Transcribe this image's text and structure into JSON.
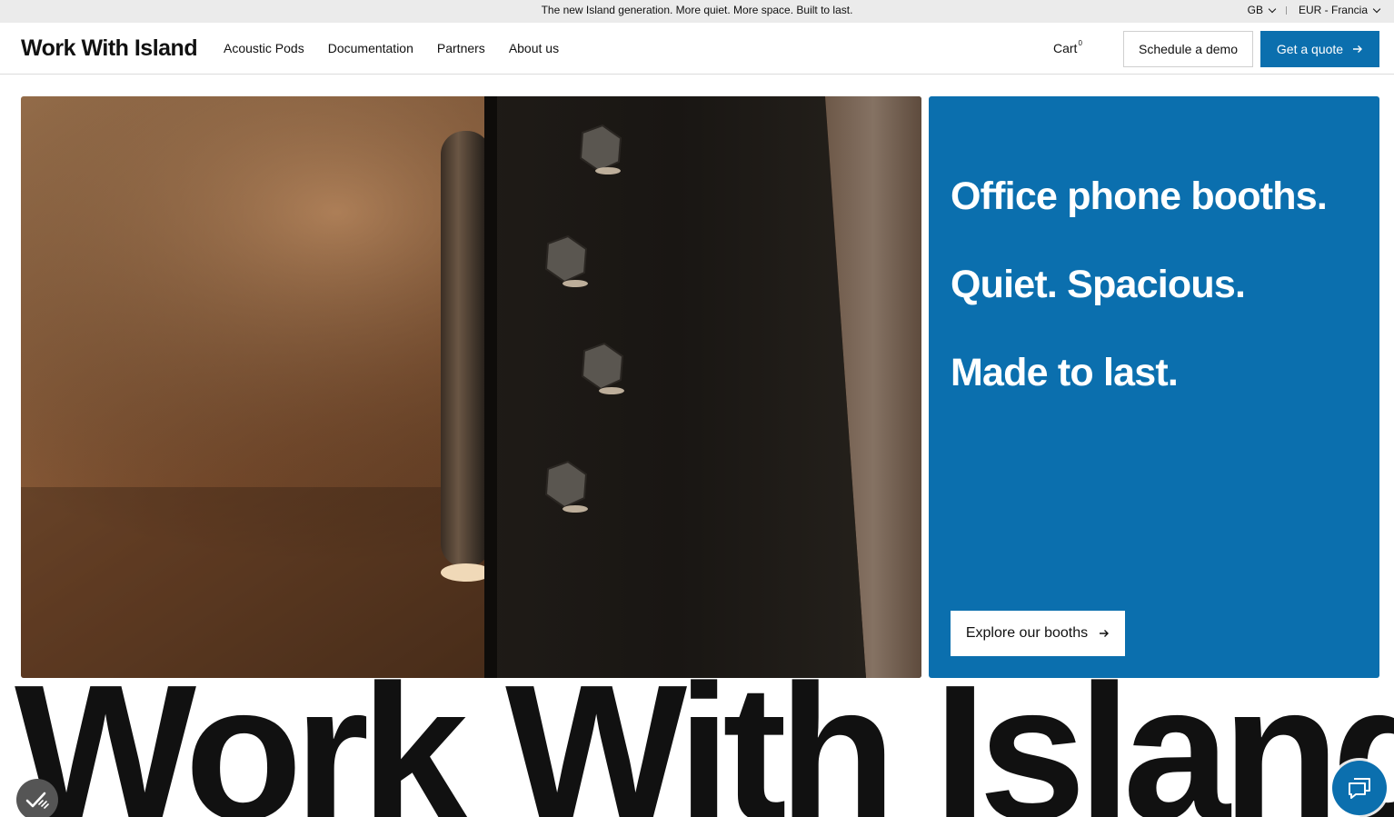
{
  "announcement": {
    "text": "The new Island generation. More quiet. More space. Built to last.",
    "region": "GB",
    "currency": "EUR - Francia"
  },
  "header": {
    "logo": "Work With Island",
    "nav": [
      {
        "label": "Acoustic Pods"
      },
      {
        "label": "Documentation"
      },
      {
        "label": "Partners"
      },
      {
        "label": "About us"
      }
    ],
    "cart_label": "Cart",
    "cart_count": "0",
    "demo_label": "Schedule a demo",
    "quote_label": "Get a quote"
  },
  "hero": {
    "headline_1": "Office phone booths.",
    "headline_2": "Quiet. Spacious.",
    "headline_3": "Made to last.",
    "cta_label": "Explore our booths"
  },
  "wordmark": "Work With Island",
  "colors": {
    "accent": "#0b6fae",
    "topbar_bg": "#ebebeb",
    "text": "#111111"
  },
  "icons": {
    "quote_button": "arrow-right-icon",
    "explore_button": "arrow-right-icon",
    "accessibility": "accessibility-check-icon",
    "chat": "chat-bubbles-icon"
  }
}
